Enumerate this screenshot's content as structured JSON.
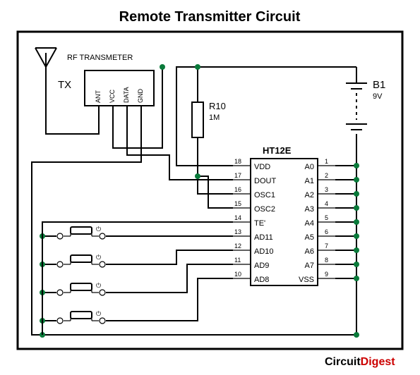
{
  "title": "Remote Transmitter Circuit",
  "tx_block": {
    "rf_label": "RF TRANSMETER",
    "tx_label": "TX",
    "pins": {
      "ant": "ANT",
      "vcc": "VCC",
      "data": "DATA",
      "gnd": "GND"
    }
  },
  "resistor": {
    "ref": "R10",
    "value": "1M"
  },
  "battery": {
    "ref": "B1",
    "value": "9V"
  },
  "ic": {
    "ref": "HT12E",
    "left_pins": [
      {
        "num": "18",
        "name": "VDD"
      },
      {
        "num": "17",
        "name": "DOUT"
      },
      {
        "num": "16",
        "name": "OSC1"
      },
      {
        "num": "15",
        "name": "OSC2"
      },
      {
        "num": "14",
        "name": "TE'"
      },
      {
        "num": "13",
        "name": "AD11"
      },
      {
        "num": "12",
        "name": "AD10"
      },
      {
        "num": "11",
        "name": "AD9"
      },
      {
        "num": "10",
        "name": "AD8"
      }
    ],
    "right_pins": [
      {
        "num": "1",
        "name": "A0"
      },
      {
        "num": "2",
        "name": "A1"
      },
      {
        "num": "3",
        "name": "A2"
      },
      {
        "num": "4",
        "name": "A3"
      },
      {
        "num": "5",
        "name": "A4"
      },
      {
        "num": "6",
        "name": "A5"
      },
      {
        "num": "7",
        "name": "A6"
      },
      {
        "num": "8",
        "name": "A7"
      },
      {
        "num": "9",
        "name": "VSS"
      }
    ]
  },
  "switches": {
    "s1": "⏻",
    "s2": "⏻",
    "s3": "⏻",
    "s4": "⏻"
  },
  "brand": {
    "a": "Circuit",
    "b": "Digest"
  }
}
